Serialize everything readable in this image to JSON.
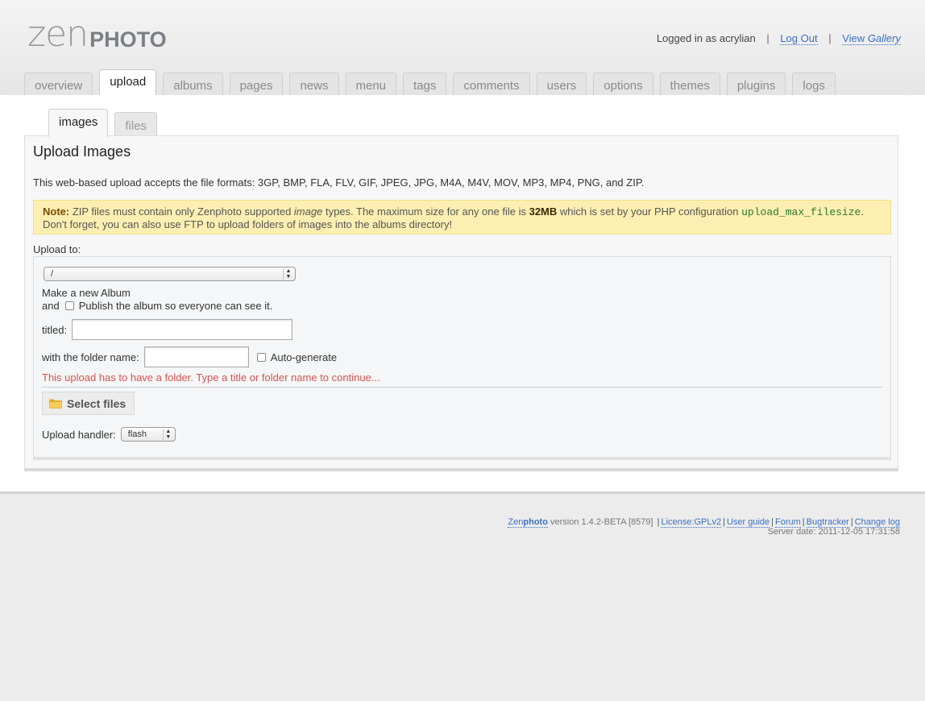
{
  "logo": {
    "zen": "zen",
    "photo": "PHOTO"
  },
  "userbar": {
    "logged_in_text": "Logged in as acrylian",
    "separator": "|",
    "logout": "Log Out",
    "view": "View",
    "gallery": "Gallery"
  },
  "main_tabs": [
    "overview",
    "upload",
    "albums",
    "pages",
    "news",
    "menu",
    "tags",
    "comments",
    "users",
    "options",
    "themes",
    "plugins",
    "logs"
  ],
  "sub_tabs": [
    "images",
    "files"
  ],
  "panel": {
    "title": "Upload Images",
    "formats": "This web-based upload accepts the file formats: 3GP, BMP, FLA, FLV, GIF, JPEG, JPG, M4A, M4V, MOV, MP3, MP4, PNG, and ZIP.",
    "note": {
      "label": "Note:",
      "t1": " ZIP files must contain only Zenphoto supported ",
      "image_word": "image",
      "t2": " types. The maximum size for any one file is ",
      "size": "32MB",
      "t3": " which is set by your PHP configuration ",
      "code": "upload_max_filesize",
      "t4": ".",
      "line2": "Don't forget, you can also use FTP to upload folders of images into the albums directory!"
    },
    "upload_to_label": "Upload to:",
    "album_select_value": "/",
    "new_album_label": "Make a new Album",
    "and_label": "and",
    "publish_label": "Publish the album so everyone can see it.",
    "titled_label": "titled:",
    "titled_value": "",
    "folder_label": "with the folder name:",
    "folder_value": "",
    "autogenerate_label": "Auto-generate",
    "warning": "This upload has to have a folder. Type a title or folder name to continue...",
    "select_files_label": "Select files",
    "handler_label": "Upload handler:",
    "handler_value": "flash"
  },
  "footer": {
    "zen": "Zen",
    "photo": "photo",
    "version": " version 1.4.2-BETA [8579] ",
    "license": "License:GPLv2",
    "user_guide": "User guide",
    "forum": "Forum",
    "bugtracker": "Bugtracker",
    "changelog": "Change log",
    "server_date": "Server date: 2011-12-05 17:31:58"
  },
  "colors": {
    "link": "#3a6fc4",
    "note_bg": "#fdefb2",
    "warning": "#d9534f",
    "code": "#2a7a2a"
  },
  "icons": [
    "folder-icon",
    "stepper-arrows-icon"
  ]
}
